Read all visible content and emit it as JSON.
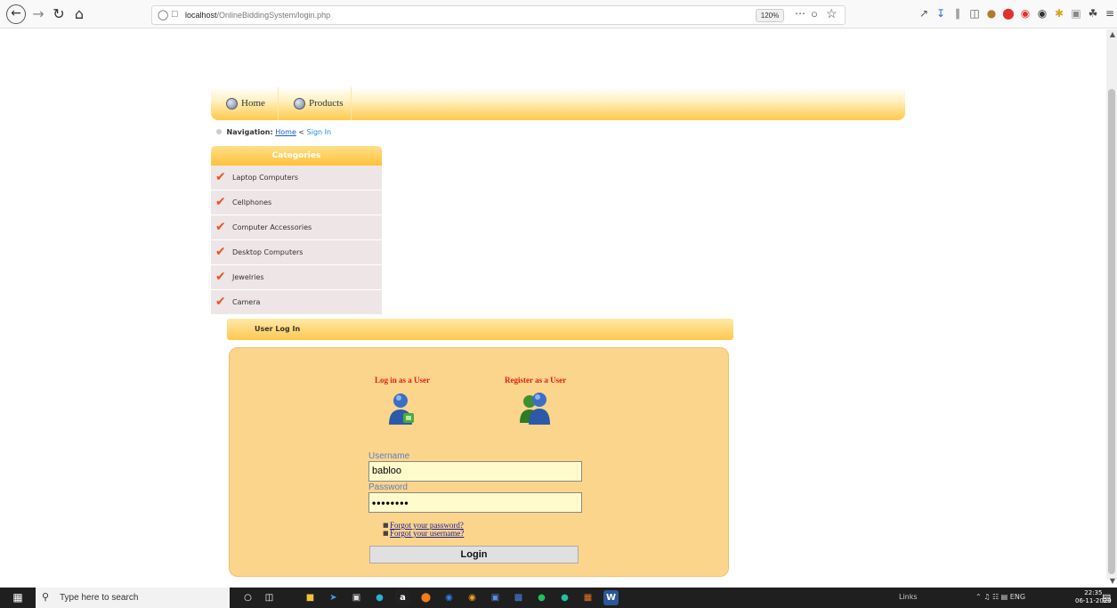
{
  "browser": {
    "url_host": "localhost",
    "url_path": "/OnlineBiddingSystem/login.php",
    "zoom": "120%"
  },
  "menu": {
    "items": [
      {
        "label": "Home"
      },
      {
        "label": "Products"
      }
    ]
  },
  "breadcrumb": {
    "title": "Navigation:",
    "home": "Home",
    "separator": " < ",
    "current": "Sign In"
  },
  "categories": {
    "header": "Categories",
    "items": [
      {
        "label": "Laptop Computers"
      },
      {
        "label": "Cellphones"
      },
      {
        "label": "Computer Accessories"
      },
      {
        "label": "Desktop Computers"
      },
      {
        "label": "Jewelries"
      },
      {
        "label": "Camera"
      }
    ]
  },
  "login": {
    "header": "User Log In",
    "option_login": "Log in as a User",
    "option_register": "Register as a User",
    "username_label": "Username",
    "username_value": "babloo",
    "password_label": "Password",
    "password_value": "••••••••",
    "forgot_password": "Forgot your password?",
    "forgot_username": "Forgot your username?",
    "button": "Login"
  },
  "taskbar": {
    "search_placeholder": "Type here to search",
    "links": "Links",
    "language": "ENG",
    "time": "22:35",
    "date": "06-11-2020"
  },
  "colors": {
    "accent": "#ffc84e",
    "login_box": "#fcd58c",
    "label_red": "#e0201a",
    "link_blue": "#1a5cd8"
  }
}
